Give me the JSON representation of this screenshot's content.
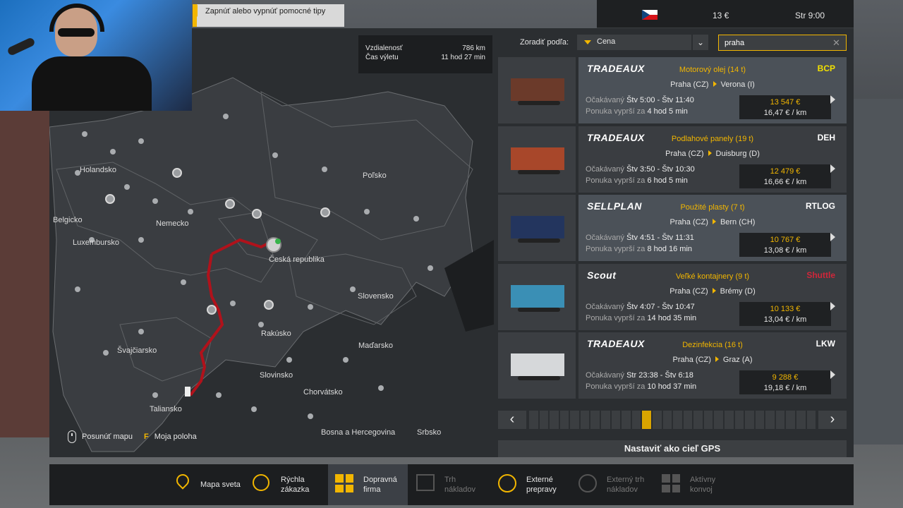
{
  "tip": {
    "text": "Zapnúť alebo vypnúť pomocné tipy"
  },
  "topbar": {
    "money": "13 €",
    "time": "Str 9:00",
    "flag_icon": "czech-flag"
  },
  "map": {
    "distance_label": "Vzdialenosť",
    "distance_value": "786 km",
    "trip_label": "Čas výletu",
    "trip_value": "11 hod 27 min",
    "legend_move": "Posunúť mapu",
    "legend_key": "F",
    "legend_position": "Moja poloha",
    "countries": [
      "Holandsko",
      "Belgicko",
      "Luxembursko",
      "Nemecko",
      "Poľsko",
      "Česká republika",
      "Slovensko",
      "Rakúsko",
      "Maďarsko",
      "Švajčiarsko",
      "Slovinsko",
      "Chorvátsko",
      "Taliansko",
      "Bosna a Hercegovina",
      "Srbsko"
    ],
    "route_color": "#b0121b"
  },
  "sort": {
    "label": "Zoradiť podľa:",
    "selected": "Cena",
    "search_value": "praha"
  },
  "jobs": [
    {
      "company": "TRADEAUX",
      "cargo": "Motorový olej  (14 t)",
      "from": "Praha (CZ)",
      "to": "Verona (I)",
      "dest_company": "BCP",
      "expect_label": "Očakávaný",
      "expect": "Štv 5:00 - Štv 11:40",
      "expire_label": "Ponuka vyprší za",
      "expire": "4 hod 5 min",
      "price": "13 547 €",
      "rate": "16,47 € / km",
      "trailer_color": "#6b3a2a"
    },
    {
      "company": "TRADEAUX",
      "cargo": "Podlahové panely  (19 t)",
      "from": "Praha (CZ)",
      "to": "Duisburg (D)",
      "dest_company": "DEH",
      "expect_label": "Očakávaný",
      "expect": "Štv 3:50 - Štv 10:30",
      "expire_label": "Ponuka vyprší za",
      "expire": "6 hod 5 min",
      "price": "12 479 €",
      "rate": "16,66 € / km",
      "trailer_color": "#a8472a"
    },
    {
      "company": "SELLPLAN",
      "cargo": "Použité plasty  (7 t)",
      "from": "Praha (CZ)",
      "to": "Bern (CH)",
      "dest_company": "RTLOG",
      "expect_label": "Očakávaný",
      "expect": "Štv 4:51 - Štv 11:31",
      "expire_label": "Ponuka vyprší za",
      "expire": "8 hod 16 min",
      "price": "10 767 €",
      "rate": "13,08 € / km",
      "trailer_color": "#23355e"
    },
    {
      "company": "Scout",
      "cargo": "Veľké kontajnery  (9 t)",
      "from": "Praha (CZ)",
      "to": "Brémy (D)",
      "dest_company": "Shuttle",
      "expect_label": "Očakávaný",
      "expect": "Štv 4:07 - Štv 10:47",
      "expire_label": "Ponuka vyprší za",
      "expire": "14 hod 35 min",
      "price": "10 133 €",
      "rate": "13,04 € / km",
      "trailer_color": "#3a8fb5"
    },
    {
      "company": "TRADEAUX",
      "cargo": "Dezinfekcia  (16 t)",
      "from": "Praha (CZ)",
      "to": "Graz (A)",
      "dest_company": "LKW",
      "expect_label": "Očakávaný",
      "expect": "Str 23:38 - Štv 6:18",
      "expire_label": "Ponuka vyprší za",
      "expire": "10 hod 37 min",
      "price": "9 288 €",
      "rate": "19,18 € / km",
      "trailer_color": "#d6d8da"
    }
  ],
  "pager": {
    "prev": "‹",
    "next": "›",
    "segments": 28,
    "active_index": 11
  },
  "gps_button": "Nastaviť ako cieľ GPS",
  "nav": [
    {
      "label": "Mapa sveta",
      "icon": "map-pin-icon",
      "state": "normal"
    },
    {
      "label": "Rýchla zákazka",
      "icon": "clock-icon",
      "state": "normal"
    },
    {
      "label": "Dopravná firma",
      "icon": "cargo-grid-icon",
      "state": "active"
    },
    {
      "label": "Trh nákladov",
      "icon": "forklift-icon",
      "state": "disabled"
    },
    {
      "label": "Externé prepravy",
      "icon": "globe-icon",
      "state": "normal"
    },
    {
      "label": "Externý trh nákladov",
      "icon": "globe-forklift-icon",
      "state": "disabled"
    },
    {
      "label": "Aktívny konvoj",
      "icon": "convoy-icon",
      "state": "disabled"
    }
  ]
}
